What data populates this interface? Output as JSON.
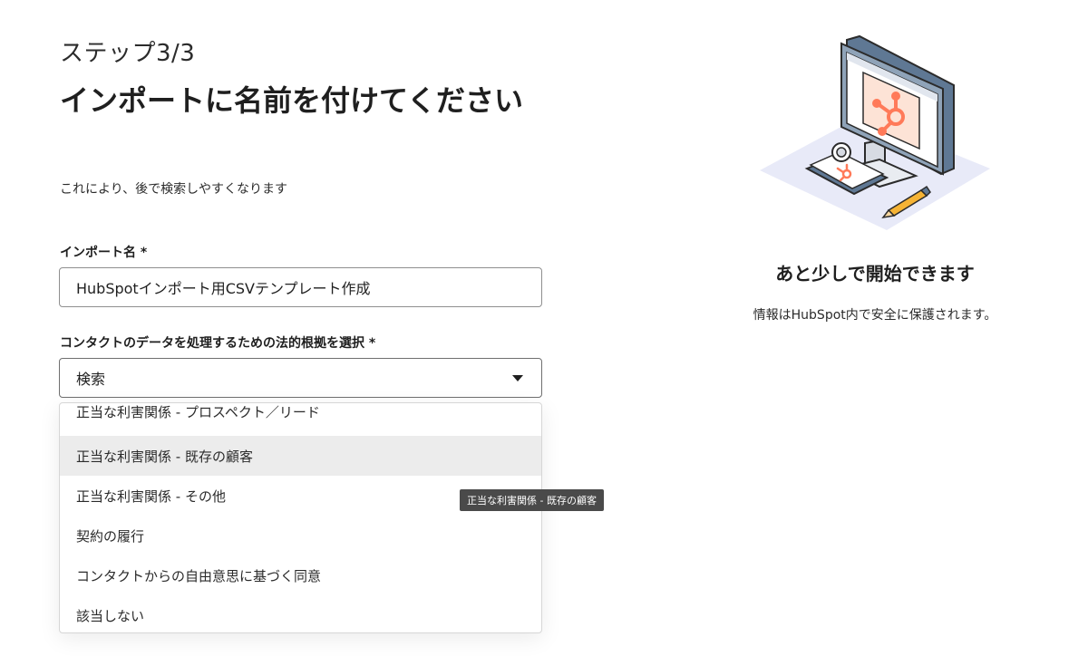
{
  "header": {
    "step": "ステップ3/3",
    "title": "インポートに名前を付けてください",
    "subtitle": "これにより、後で検索しやすくなります"
  },
  "form": {
    "import_name_label": "インポート名 *",
    "import_name_value": "HubSpotインポート用CSVテンプレート作成",
    "legal_basis_label": "コンタクトのデータを処理するための法的根拠を選択 *",
    "legal_basis_value": "検索"
  },
  "dropdown": {
    "options": [
      "正当な利害関係 - プロスペクト／リード",
      "正当な利害関係 - 既存の顧客",
      "正当な利害関係 - その他",
      "契約の履行",
      "コンタクトからの自由意思に基づく同意",
      "該当しない"
    ],
    "hovered_option": "正当な利害関係 - 既存の顧客"
  },
  "tooltip": {
    "text": "正当な利害関係 - 既存の顧客"
  },
  "promo": {
    "title": "あと少しで開始できます",
    "text": "情報はHubSpot内で安全に保護されます。"
  },
  "colors": {
    "brand_orange": "#ff7a59",
    "monitor_frame": "#5f7894",
    "platform": "#e8eaf8",
    "hover_bg": "#ececec",
    "tooltip_bg": "#4a4a4a"
  }
}
